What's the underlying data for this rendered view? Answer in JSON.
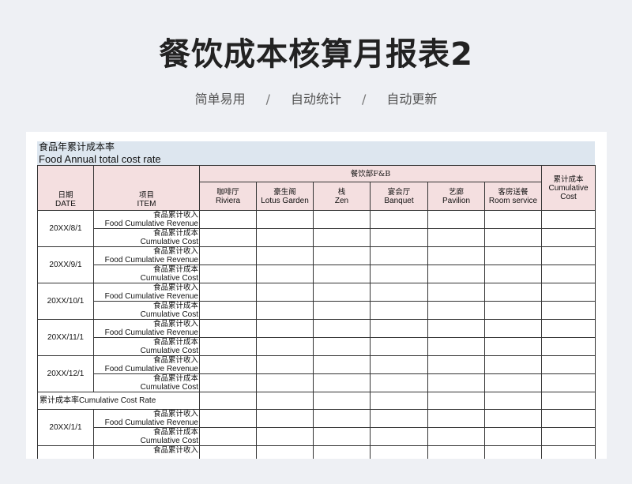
{
  "header": {
    "title": "餐饮成本核算月报表2",
    "tags": [
      "简单易用",
      "自动统计",
      "自动更新"
    ],
    "separator": "/"
  },
  "sheet": {
    "banner_line1": "食品年累计成本率",
    "banner_line2": "Food Annual total cost rate",
    "dept_header": "餐饮部F&B",
    "date_header_cn": "日期",
    "date_header_en": "DATE",
    "item_header_cn": "项目",
    "item_header_en": "ITEM",
    "total_header_cn": "累计成本",
    "total_header_en": "Cumulative Cost",
    "outlets": [
      {
        "cn": "咖啡厅",
        "en": "Riviera"
      },
      {
        "cn": "豪生阁",
        "en": "Lotus Garden"
      },
      {
        "cn": "栈",
        "en": "Zen"
      },
      {
        "cn": "宴会厅",
        "en": "Banquet"
      },
      {
        "cn": "艺廊",
        "en": "Pavilion"
      },
      {
        "cn": "客房送餐",
        "en": "Room service"
      }
    ],
    "revenue_cn": "食品累计收入",
    "revenue_en": "Food Cumulative  Revenue",
    "cost_cn": "食品累计成本",
    "cost_en": "Cumulative Cost",
    "dates": [
      "20XX/8/1",
      "20XX/9/1",
      "20XX/10/1",
      "20XX/11/1",
      "20XX/12/1"
    ],
    "section_label": "累计成本率Cumulative Cost Rate",
    "dates2": [
      "20XX/1/1"
    ],
    "partial_revenue_cn": "食品累计收入"
  }
}
